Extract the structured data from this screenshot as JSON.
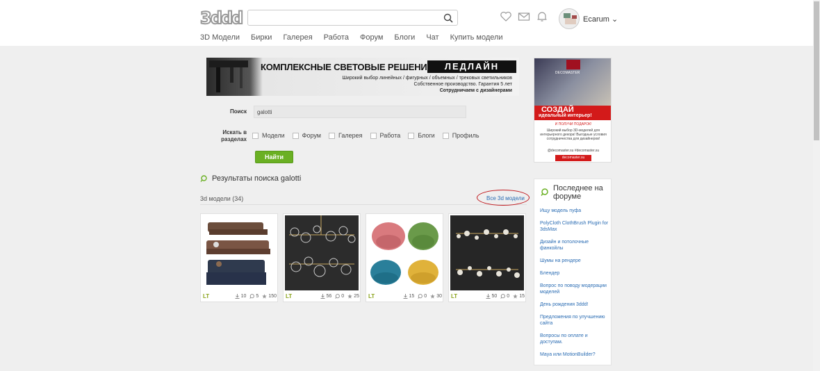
{
  "header": {
    "logo": "3ddd",
    "search_placeholder": "",
    "user_name": "Ecarum",
    "nav": [
      "3D Модели",
      "Бирки",
      "Галерея",
      "Работа",
      "Форум",
      "Блоги",
      "Чат",
      "Купить модели"
    ]
  },
  "banner": {
    "title": "КОМПЛЕКСНЫЕ СВЕТОВЫЕ РЕШЕНИЯ",
    "brand": "ЛЕДЛАЙН",
    "line1": "Широкий выбор линейных / фигурных / объемных / трековых светильников",
    "line2": "Собственное производство. Гарантия 5 лет",
    "line3": "Сотрудничаем с дизайнерами"
  },
  "side_ad": {
    "brand": "DECOMASTER",
    "headline": "СОЗДАЙ",
    "subline": "идеальный интерьер!",
    "gift": "И ПОЛУЧИ ПОДАРОК!",
    "text": "Широкий выбор 3D-моделей для интерьерного декора! Выгодные условия сотрудничества для дизайнеров!",
    "socials": "@decomaster.su   #decomaster.su",
    "site": "decomaster.su"
  },
  "form": {
    "search_label": "Поиск",
    "query": "galotti",
    "sections_label": "Искать в разделах",
    "sections": [
      "Модели",
      "Форум",
      "Галерея",
      "Работа",
      "Блоги",
      "Профиль"
    ],
    "submit": "Найти"
  },
  "results": {
    "title": "Результаты поиска galotti",
    "subtitle": "3d модели (34)",
    "all_link": "Все 3d модели",
    "cards": [
      {
        "badge": "LT",
        "downloads": "10",
        "comments": "5",
        "rating": "150"
      },
      {
        "badge": "LT",
        "downloads": "56",
        "comments": "0",
        "rating": "25"
      },
      {
        "badge": "LT",
        "downloads": "15",
        "comments": "0",
        "rating": "30"
      },
      {
        "badge": "LT",
        "downloads": "50",
        "comments": "0",
        "rating": "15"
      }
    ]
  },
  "forum": {
    "title": "Последнее на форуме",
    "items": [
      "Ищу модель пуфа",
      "PolyCloth ClothBrush Plugin for 3dsMax",
      "Дизайн и потолочные фанкойлы",
      "Шумы на рендере",
      "Блендер",
      "Вопрос по поводу модерации моделей",
      "День рождения 3ddd!",
      "Предложения по улучшению сайта",
      "Вопросы по оплате и доступам.",
      "Maya или MotionBuilder?"
    ]
  },
  "colors": {
    "accent_green": "#6ab023",
    "link_blue": "#2a6cb3",
    "annotation_red": "#c0161b"
  }
}
